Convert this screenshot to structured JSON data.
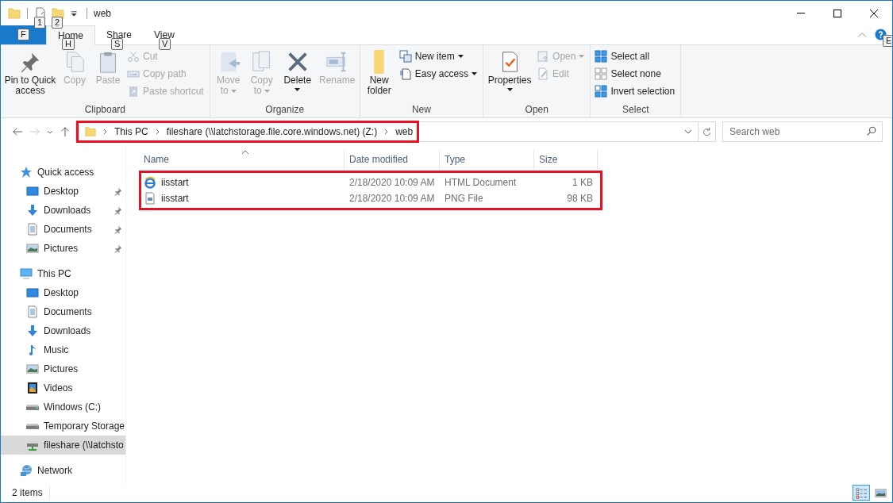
{
  "window": {
    "title": "web",
    "quick_access_keytips": [
      "1",
      "2"
    ]
  },
  "ribbon": {
    "file_tab": {
      "keytip": "F"
    },
    "tabs": [
      {
        "label": "Home",
        "keytip": "H",
        "selected": true
      },
      {
        "label": "Share",
        "keytip": "S",
        "selected": false
      },
      {
        "label": "View",
        "keytip": "V",
        "selected": false
      }
    ],
    "help_keytip": "E",
    "groups": [
      {
        "label": "Clipboard",
        "items": [
          {
            "kind": "large",
            "label": "Pin to Quick access",
            "disabled": false
          },
          {
            "kind": "large",
            "label": "Copy",
            "disabled": true
          },
          {
            "kind": "large",
            "label": "Paste",
            "disabled": true
          },
          {
            "kind": "stack",
            "items": [
              {
                "label": "Cut",
                "disabled": true
              },
              {
                "label": "Copy path",
                "disabled": true
              },
              {
                "label": "Paste shortcut",
                "disabled": true
              }
            ]
          }
        ]
      },
      {
        "label": "Organize",
        "items": [
          {
            "kind": "large",
            "label": "Move to",
            "disabled": true,
            "dropdown": true,
            "caret_below": false
          },
          {
            "kind": "large",
            "label": "Copy to",
            "disabled": true,
            "dropdown": true,
            "caret_below": false
          },
          {
            "kind": "large",
            "label": "Delete",
            "disabled": false,
            "dropdown": true,
            "caret_below": true
          },
          {
            "kind": "large",
            "label": "Rename",
            "disabled": true
          }
        ]
      },
      {
        "label": "New",
        "items": [
          {
            "kind": "large",
            "label": "New folder",
            "disabled": false
          },
          {
            "kind": "stack",
            "items": [
              {
                "label": "New item",
                "disabled": false,
                "dropdown": true
              },
              {
                "label": "Easy access",
                "disabled": false,
                "dropdown": true
              }
            ]
          }
        ]
      },
      {
        "label": "Open",
        "items": [
          {
            "kind": "large",
            "label": "Properties",
            "disabled": false,
            "dropdown": true,
            "caret_below": true
          },
          {
            "kind": "stack",
            "items": [
              {
                "label": "Open",
                "disabled": true,
                "dropdown": true
              },
              {
                "label": "Edit",
                "disabled": true
              }
            ]
          }
        ]
      },
      {
        "label": "Select",
        "items": [
          {
            "kind": "stack",
            "items": [
              {
                "label": "Select all",
                "disabled": false
              },
              {
                "label": "Select none",
                "disabled": false
              },
              {
                "label": "Invert selection",
                "disabled": false
              }
            ]
          }
        ]
      }
    ]
  },
  "address": {
    "back_disabled": false,
    "forward_disabled": true,
    "path": [
      "This PC",
      "fileshare (\\\\latchstorage.file.core.windows.net) (Z:)",
      "web"
    ],
    "search": {
      "placeholder": "Search web"
    }
  },
  "navigation": [
    {
      "label": "Quick access",
      "selected": false,
      "children": [
        {
          "label": "Desktop",
          "pinned": true,
          "selected": false
        },
        {
          "label": "Downloads",
          "pinned": true,
          "selected": false
        },
        {
          "label": "Documents",
          "pinned": true,
          "selected": false
        },
        {
          "label": "Pictures",
          "pinned": true,
          "selected": false
        }
      ]
    },
    {
      "label": "This PC",
      "selected": false,
      "children": [
        {
          "label": "Desktop",
          "selected": false
        },
        {
          "label": "Documents",
          "selected": false
        },
        {
          "label": "Downloads",
          "selected": false
        },
        {
          "label": "Music",
          "selected": false
        },
        {
          "label": "Pictures",
          "selected": false
        },
        {
          "label": "Videos",
          "selected": false
        },
        {
          "label": "Windows (C:)",
          "selected": false
        },
        {
          "label": "Temporary Storage",
          "selected": false
        },
        {
          "label": "fileshare (\\\\latchsto",
          "selected": true
        }
      ]
    },
    {
      "label": "Network",
      "selected": false
    }
  ],
  "table": {
    "columns": [
      {
        "label": "Name",
        "sorted": true
      },
      {
        "label": "Date modified",
        "sorted": false
      },
      {
        "label": "Type",
        "sorted": false
      },
      {
        "label": "Size",
        "sorted": false
      }
    ],
    "rows": [
      {
        "kind": "html",
        "cells": [
          "iisstart",
          "2/18/2020 10:09 AM",
          "HTML Document",
          "1 KB"
        ]
      },
      {
        "kind": "png",
        "cells": [
          "iisstart",
          "2/18/2020 10:09 AM",
          "PNG File",
          "98 KB"
        ]
      }
    ]
  },
  "status_bar": {
    "item_count": "2 items",
    "views": [
      {
        "kind": "details",
        "selected": true
      },
      {
        "kind": "large_icons",
        "selected": false
      }
    ]
  }
}
